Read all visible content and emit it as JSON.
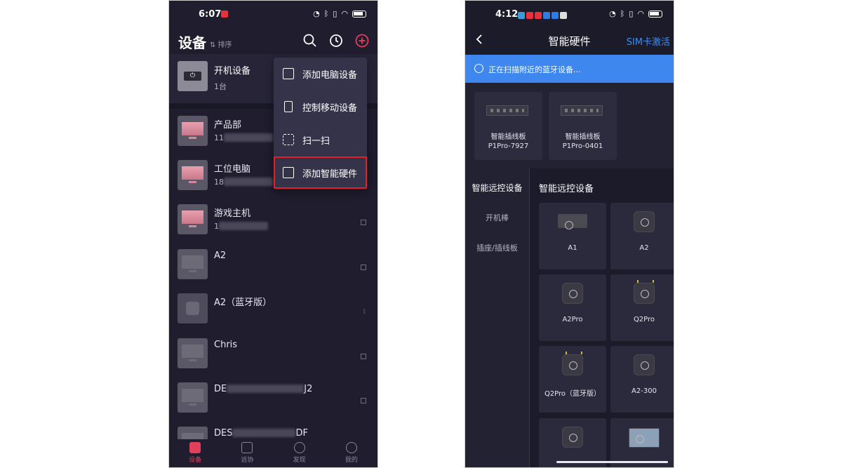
{
  "left_phone": {
    "status": {
      "time": "6:07"
    },
    "header": {
      "title": "设备",
      "sort_label": "⇅ 排序"
    },
    "power_group": {
      "name": "开机设备",
      "count": "1台"
    },
    "devices": [
      {
        "name": "产品部",
        "sub_prefix": "11",
        "sub_suffix": "30",
        "thumb": "pink"
      },
      {
        "name": "工位电脑",
        "sub_prefix": "18",
        "sub_suffix": "5",
        "thumb": "pink"
      },
      {
        "name": "游戏主机",
        "sub_prefix": "1",
        "sub_suffix": "",
        "thumb": "pink"
      },
      {
        "name": "A2",
        "sub_prefix": "",
        "sub_suffix": "",
        "thumb": "grey"
      },
      {
        "name": "A2（蓝牙版）",
        "sub_prefix": "",
        "sub_suffix": "",
        "thumb": "grey"
      },
      {
        "name": "Chris",
        "sub_prefix": "",
        "sub_suffix": "",
        "thumb": "grey"
      },
      {
        "name_prefix": "DE",
        "name_suffix": "J2",
        "thumb": "grey"
      },
      {
        "name_prefix": "DES",
        "name_suffix": "DF",
        "thumb": "grey"
      }
    ],
    "menu": {
      "items": [
        {
          "label": "添加电脑设备",
          "icon": "image-icon"
        },
        {
          "label": "控制移动设备",
          "icon": "phone-icon"
        },
        {
          "label": "扫一扫",
          "icon": "scan-icon"
        },
        {
          "label": "添加智能硬件",
          "icon": "chip-icon"
        }
      ]
    },
    "bottom_nav": [
      {
        "label": "设备",
        "icon": "devices-icon",
        "active": true
      },
      {
        "label": "远协",
        "icon": "remote-assist-icon",
        "active": false
      },
      {
        "label": "发现",
        "icon": "compass-icon",
        "active": false
      },
      {
        "label": "我的",
        "icon": "profile-icon",
        "active": false
      }
    ]
  },
  "right_phone": {
    "status": {
      "time": "4:12"
    },
    "nav": {
      "title": "智能硬件",
      "action": "SIM卡激活"
    },
    "scan_banner": "正在扫描附近的蓝牙设备...",
    "found": [
      {
        "line1": "智能插线板",
        "line2": "P1Pro-7927"
      },
      {
        "line1": "智能插线板",
        "line2": "P1Pro-0401"
      }
    ],
    "tabs": [
      "智能远控设备",
      "开机棒",
      "插座/插线板"
    ],
    "category_title": "智能远控设备",
    "catalog": [
      {
        "name": "A1",
        "style": "wide"
      },
      {
        "name": "A2",
        "style": "square"
      },
      {
        "name": "A2Pro",
        "style": "square"
      },
      {
        "name": "Q2Pro",
        "style": "antenna"
      },
      {
        "name": "Q2Pro（蓝牙版）",
        "style": "antenna"
      },
      {
        "name": "A2-300",
        "style": "square"
      },
      {
        "name": "",
        "style": "square"
      },
      {
        "name": "",
        "style": "blue"
      }
    ]
  },
  "colors": {
    "accent_red": "#e0202a",
    "scan_blue": "#3d87ee",
    "link_blue": "#3d8ef0",
    "bg_dark": "#1f1d2e"
  }
}
